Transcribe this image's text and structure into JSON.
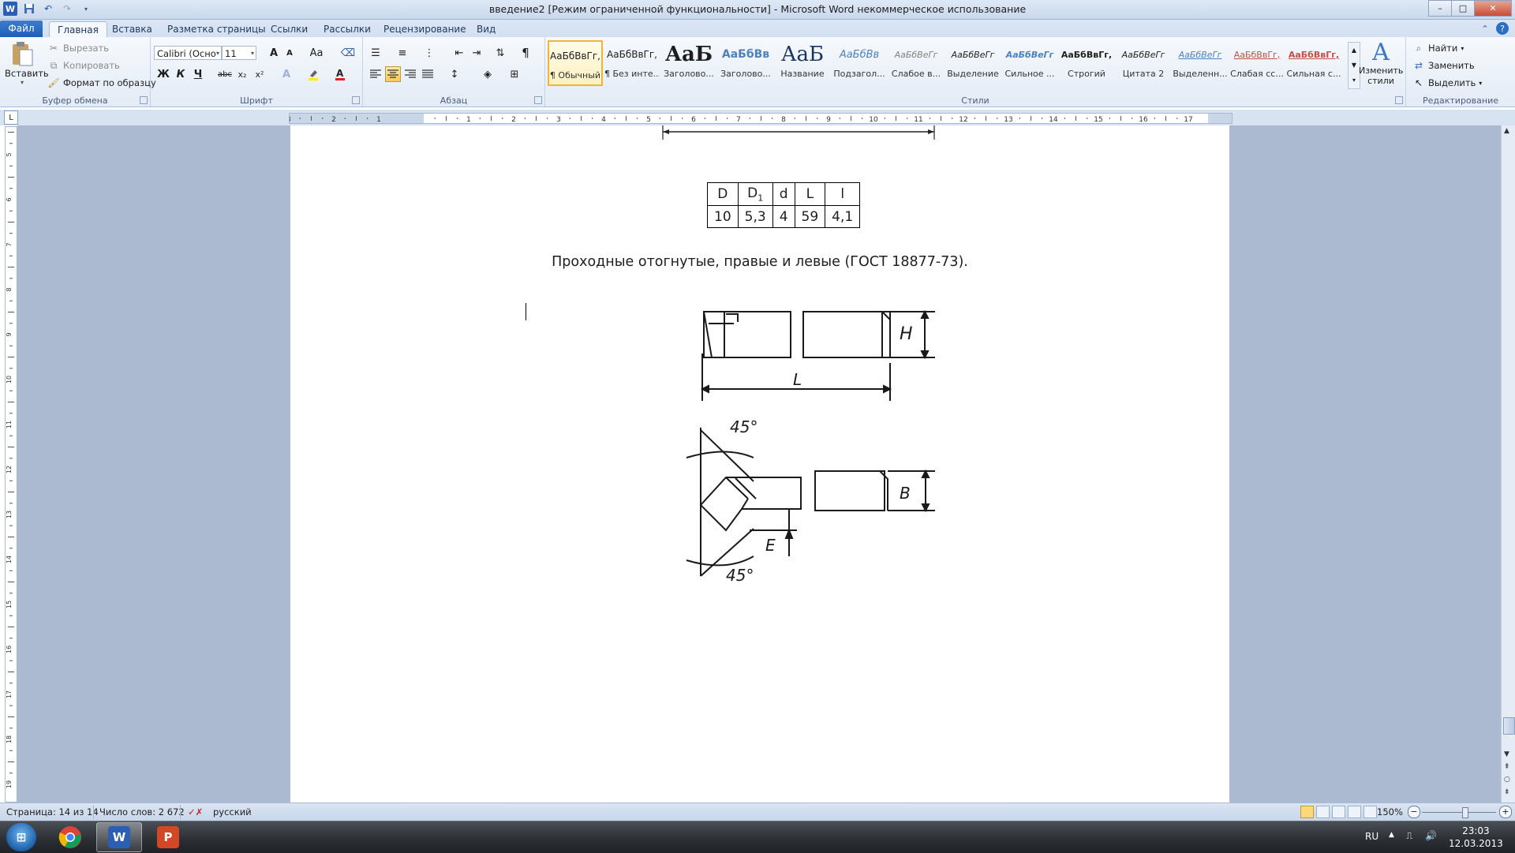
{
  "window": {
    "title": "введение2 [Режим ограниченной функциональности]  -  Microsoft Word некоммерческое использование",
    "minimize": "–",
    "maximize": "□",
    "close": "✕"
  },
  "qat": {
    "app_icon": "W",
    "save_icon": "save-icon",
    "undo_icon": "undo-icon",
    "redo_icon": "redo-icon",
    "customize_icon": "dropdown-icon"
  },
  "tabs": [
    {
      "label": "Файл"
    },
    {
      "label": "Главная"
    },
    {
      "label": "Вставка"
    },
    {
      "label": "Разметка страницы"
    },
    {
      "label": "Ссылки"
    },
    {
      "label": "Рассылки"
    },
    {
      "label": "Рецензирование"
    },
    {
      "label": "Вид"
    }
  ],
  "ribbon": {
    "clipboard": {
      "label": "Буфер обмена",
      "paste": "Вставить",
      "cut": "Вырезать",
      "copy": "Копировать",
      "format_painter": "Формат по образцу"
    },
    "font": {
      "label": "Шрифт",
      "font_name": "Calibri (Осно",
      "font_size": "11",
      "grow": "A",
      "shrink": "A",
      "case": "Aa",
      "bold": "Ж",
      "italic": "К",
      "underline": "Ч",
      "strike": "abc",
      "subscript": "x₂",
      "superscript": "x²"
    },
    "paragraph": {
      "label": "Абзац",
      "pilcrow": "¶"
    },
    "styles": {
      "label": "Стили",
      "items": [
        {
          "preview": "АаБбВвГг,",
          "name": "¶ Обычный"
        },
        {
          "preview": "АаБбВвГг,",
          "name": "¶ Без инте..."
        },
        {
          "preview": "АаБ",
          "name": "Заголово..."
        },
        {
          "preview": "АаБбВв",
          "name": "Заголово..."
        },
        {
          "preview": "АаБ",
          "name": "Название"
        },
        {
          "preview": "АаБбВв",
          "name": "Подзагол..."
        },
        {
          "preview": "АаБбВеГг",
          "name": "Слабое в..."
        },
        {
          "preview": "АаБбВеГг",
          "name": "Выделение"
        },
        {
          "preview": "АаБбВеГг",
          "name": "Сильное ..."
        },
        {
          "preview": "АаБбВвГг,",
          "name": "Строгий"
        },
        {
          "preview": "АаБбВеГг",
          "name": "Цитата 2"
        },
        {
          "preview": "АаБбВеГг",
          "name": "Выделенн..."
        },
        {
          "preview": "АаБбВвГг,",
          "name": "Слабая сс..."
        },
        {
          "preview": "АаБбВвГг,",
          "name": "Сильная с..."
        }
      ],
      "change_styles": "Изменить стили"
    },
    "editing": {
      "label": "Редактирование",
      "find": "Найти",
      "replace": "Заменить",
      "select": "Выделить"
    }
  },
  "ruler": {
    "h_numbers": [
      "3",
      "2",
      "1",
      "1",
      "2",
      "3",
      "4",
      "5",
      "6",
      "7",
      "8",
      "9",
      "10",
      "11",
      "12",
      "13",
      "14",
      "15",
      "16",
      "17"
    ],
    "v_numbers": [
      "5",
      "6",
      "7",
      "8",
      "9",
      "10",
      "11",
      "12",
      "13",
      "14",
      "15",
      "16",
      "17",
      "18",
      "19"
    ]
  },
  "document": {
    "table": {
      "headers": [
        "D",
        "D",
        "d",
        "L",
        "l"
      ],
      "header_sub": "1",
      "row": [
        "10",
        "5,3",
        "4",
        "59",
        "4,1"
      ]
    },
    "caption": "Проходные отогнутые, правые и левые (ГОСТ 18877-73).",
    "drawing_labels": {
      "h": "H",
      "l": "L",
      "b": "B",
      "e": "E",
      "angle_top": "45°",
      "angle_bottom": "45°"
    }
  },
  "statusbar": {
    "page": "Страница: 14 из 14",
    "words": "Число слов: 2 672",
    "language": "русский",
    "zoom": "150%"
  },
  "taskbar": {
    "lang": "RU",
    "time": "23:03",
    "date": "12.03.2013"
  }
}
